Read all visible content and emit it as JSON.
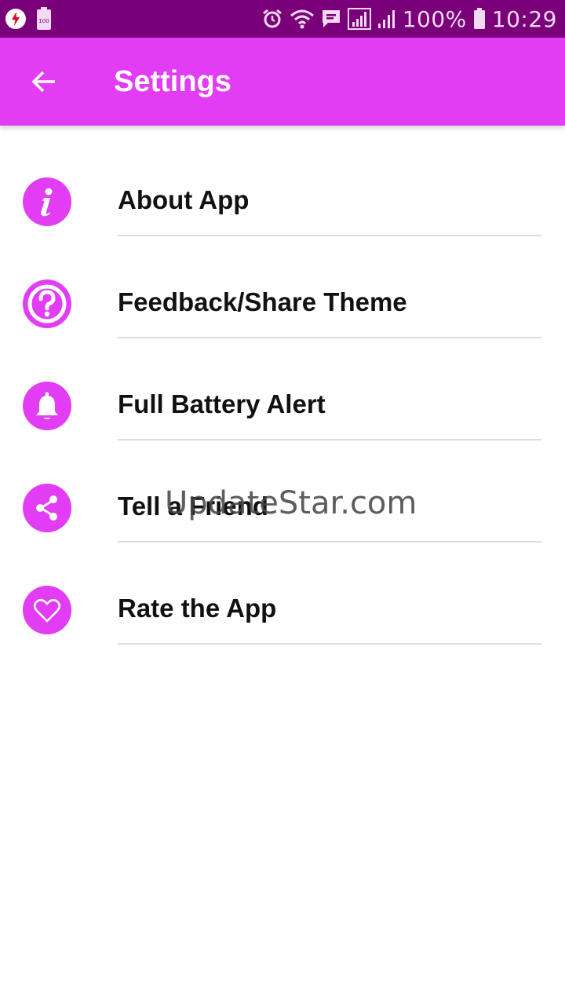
{
  "status_bar": {
    "battery_percent": "100%",
    "time": "10:29",
    "left_icons": [
      "battery-saver-icon",
      "battery-100-icon"
    ],
    "right_icons": [
      "alarm-icon",
      "wifi-icon",
      "message-icon",
      "signal-icon",
      "signal-icon",
      "battery-icon"
    ]
  },
  "app_bar": {
    "title": "Settings",
    "back_icon": "arrow-left-icon"
  },
  "menu": {
    "items": [
      {
        "label": "About App",
        "icon": "info-icon"
      },
      {
        "label": "Feedback/Share Theme",
        "icon": "question-icon"
      },
      {
        "label": "Full Battery Alert",
        "icon": "bell-icon"
      },
      {
        "label": "Tell a Friend",
        "icon": "share-icon"
      },
      {
        "label": "Rate the App",
        "icon": "heart-icon"
      }
    ]
  },
  "watermark": "UpdateStar.com",
  "colors": {
    "status_bar": "#7a007a",
    "accent": "#e23cf4",
    "text": "#111111",
    "divider": "#dddddd"
  }
}
